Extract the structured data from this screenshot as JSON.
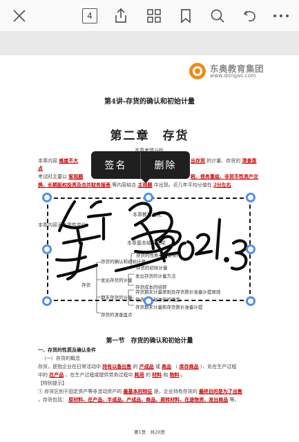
{
  "toolbar": {
    "page_count": "4"
  },
  "document": {
    "logo_name": "东奥教育集团",
    "logo_url": "www.dongao.com",
    "lecture_title": "第4讲-存货的确认和初始计量",
    "chapter_title": "第二章　存货",
    "heading_exam": "本章考情分析",
    "intro_line1_a": "本章内容",
    "intro_line1_b": "难度不大",
    "intro_line1_c": "出存货",
    "intro_line1_d": "的计量、存货的",
    "intro_line1_e": "清查盘",
    "intro_line2": "点",
    "intro_line3_a": "考试时主要以",
    "intro_line3_b": "客观题",
    "intro_line3_c": "税、债务重组、非货币性资产交",
    "intro_line4_a": "换、长期股权投资及合并财务报表",
    "intro_line4_b": "等内容结合",
    "intro_line4_c": "主观题",
    "intro_line4_d": "中出现。近几年平均分值在",
    "intro_line4_e": "2分左右",
    "heading_change": "本章教材变化",
    "change_text": "本章内容无实质性变化。",
    "heading_framework": "本章基本结构框架",
    "mind_confirm": "存货的确认和初始计量",
    "mind_nature": "存货的性质与确认条件",
    "mind_initial": "存货的初始计量",
    "mind_inventory": "存货",
    "mind_issue": "发出存货的计量",
    "mind_issue_method": "发出存货的计量方法",
    "mind_issue_cost": "存货成本的结转",
    "mind_period": "期末存货的计量",
    "mind_period_1": "存货期末计量原则及存货跌价准备计提原则",
    "mind_period_2": "存货可变现净值的确定",
    "mind_period_3": "存货期末计量和存货跌价准备计提",
    "mind_check": "存货的清查盘点",
    "section_title": "第一节　存货的确认和初始计量",
    "sub1": "一、存货的性质及确认条件",
    "sub1_1": "（一）存货的概念",
    "def_a": "存货，是指企业在日常活动中",
    "def_b": "持有以备出售",
    "def_c": "的",
    "def_d": "产成品",
    "def_e": "或",
    "def_f": "商品",
    "def_g": "（",
    "def_h": "库存商品",
    "def_i": "）、处在生产过程",
    "def2_a": "中的",
    "def2_b": "在产品",
    "def2_c": "、在生产过程或提供劳务过程中",
    "def2_d": "耗用",
    "def2_e": "的",
    "def2_f": "材料",
    "def2_g": "和",
    "def2_h": "物料",
    "def2_i": "。",
    "tip": "【特别提示】",
    "tip1_a": "① 存货区别于固定资产等非流动资产的",
    "tip1_b": "最基本的特征",
    "tip1_c": "是，企业持有存货的",
    "tip1_d": "最终目的是为了出售",
    "tip2_a": "，存货包括：",
    "tip2_b": "原材料、在产品、半成品、产成品、商品、周转材料、在途物资、发出商品",
    "tip2_c": "等。",
    "footer": "第1页　共20页"
  },
  "popup": {
    "sign_label": "签名",
    "delete_label": "删除"
  },
  "signature": {
    "text": "签名 2021.3"
  }
}
